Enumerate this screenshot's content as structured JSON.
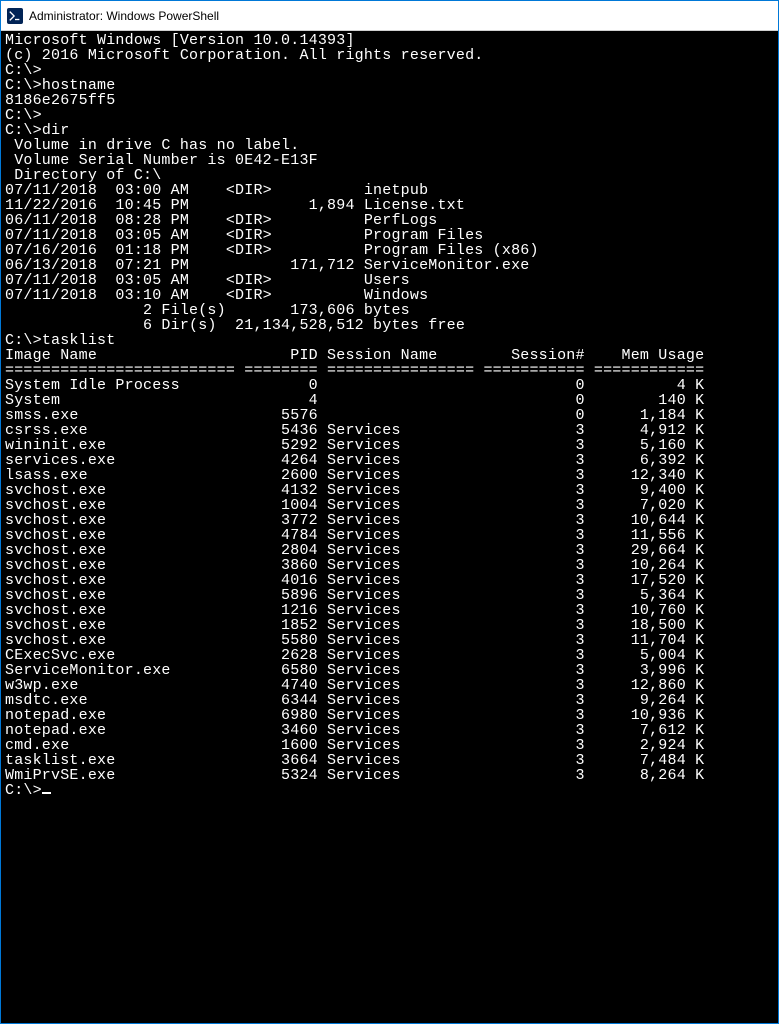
{
  "titlebar": {
    "title": "Administrator: Windows PowerShell"
  },
  "banner": {
    "line1": "Microsoft Windows [Version 10.0.14393]",
    "line2": "(c) 2016 Microsoft Corporation. All rights reserved."
  },
  "prompt": "C:\\>",
  "sessions": {
    "hostname": {
      "cmd": "hostname",
      "output": "8186e2675ff5"
    },
    "dir": {
      "cmd": "dir",
      "vol_line1": " Volume in drive C has no label.",
      "vol_line2": " Volume Serial Number is 0E42-E13F",
      "dir_of": " Directory of C:\\",
      "entries": [
        {
          "date": "07/11/2018",
          "time": "03:00 AM",
          "type": "<DIR>",
          "size": "",
          "name": "inetpub"
        },
        {
          "date": "11/22/2016",
          "time": "10:45 PM",
          "type": "",
          "size": "1,894",
          "name": "License.txt"
        },
        {
          "date": "06/11/2018",
          "time": "08:28 PM",
          "type": "<DIR>",
          "size": "",
          "name": "PerfLogs"
        },
        {
          "date": "07/11/2018",
          "time": "03:05 AM",
          "type": "<DIR>",
          "size": "",
          "name": "Program Files"
        },
        {
          "date": "07/16/2016",
          "time": "01:18 PM",
          "type": "<DIR>",
          "size": "",
          "name": "Program Files (x86)"
        },
        {
          "date": "06/13/2018",
          "time": "07:21 PM",
          "type": "",
          "size": "171,712",
          "name": "ServiceMonitor.exe"
        },
        {
          "date": "07/11/2018",
          "time": "03:05 AM",
          "type": "<DIR>",
          "size": "",
          "name": "Users"
        },
        {
          "date": "07/11/2018",
          "time": "03:10 AM",
          "type": "<DIR>",
          "size": "",
          "name": "Windows"
        }
      ],
      "summary1": {
        "count": "2",
        "label": "File(s)",
        "bytes": "173,606",
        "suffix": "bytes"
      },
      "summary2": {
        "count": "6",
        "label": "Dir(s)",
        "bytes": "21,134,528,512",
        "suffix": "bytes free"
      }
    },
    "tasklist": {
      "cmd": "tasklist",
      "headers": {
        "image": "Image Name",
        "pid": "PID",
        "session": "Session Name",
        "num": "Session#",
        "mem": "Mem Usage"
      },
      "rows": [
        {
          "image": "System Idle Process",
          "pid": "0",
          "session": "",
          "num": "0",
          "mem": "4 K"
        },
        {
          "image": "System",
          "pid": "4",
          "session": "",
          "num": "0",
          "mem": "140 K"
        },
        {
          "image": "smss.exe",
          "pid": "5576",
          "session": "",
          "num": "0",
          "mem": "1,184 K"
        },
        {
          "image": "csrss.exe",
          "pid": "5436",
          "session": "Services",
          "num": "3",
          "mem": "4,912 K"
        },
        {
          "image": "wininit.exe",
          "pid": "5292",
          "session": "Services",
          "num": "3",
          "mem": "5,160 K"
        },
        {
          "image": "services.exe",
          "pid": "4264",
          "session": "Services",
          "num": "3",
          "mem": "6,392 K"
        },
        {
          "image": "lsass.exe",
          "pid": "2600",
          "session": "Services",
          "num": "3",
          "mem": "12,340 K"
        },
        {
          "image": "svchost.exe",
          "pid": "4132",
          "session": "Services",
          "num": "3",
          "mem": "9,400 K"
        },
        {
          "image": "svchost.exe",
          "pid": "1004",
          "session": "Services",
          "num": "3",
          "mem": "7,020 K"
        },
        {
          "image": "svchost.exe",
          "pid": "3772",
          "session": "Services",
          "num": "3",
          "mem": "10,644 K"
        },
        {
          "image": "svchost.exe",
          "pid": "4784",
          "session": "Services",
          "num": "3",
          "mem": "11,556 K"
        },
        {
          "image": "svchost.exe",
          "pid": "2804",
          "session": "Services",
          "num": "3",
          "mem": "29,664 K"
        },
        {
          "image": "svchost.exe",
          "pid": "3860",
          "session": "Services",
          "num": "3",
          "mem": "10,264 K"
        },
        {
          "image": "svchost.exe",
          "pid": "4016",
          "session": "Services",
          "num": "3",
          "mem": "17,520 K"
        },
        {
          "image": "svchost.exe",
          "pid": "5896",
          "session": "Services",
          "num": "3",
          "mem": "5,364 K"
        },
        {
          "image": "svchost.exe",
          "pid": "1216",
          "session": "Services",
          "num": "3",
          "mem": "10,760 K"
        },
        {
          "image": "svchost.exe",
          "pid": "1852",
          "session": "Services",
          "num": "3",
          "mem": "18,500 K"
        },
        {
          "image": "svchost.exe",
          "pid": "5580",
          "session": "Services",
          "num": "3",
          "mem": "11,704 K"
        },
        {
          "image": "CExecSvc.exe",
          "pid": "2628",
          "session": "Services",
          "num": "3",
          "mem": "5,004 K"
        },
        {
          "image": "ServiceMonitor.exe",
          "pid": "6580",
          "session": "Services",
          "num": "3",
          "mem": "3,996 K"
        },
        {
          "image": "w3wp.exe",
          "pid": "4740",
          "session": "Services",
          "num": "3",
          "mem": "12,860 K"
        },
        {
          "image": "msdtc.exe",
          "pid": "6344",
          "session": "Services",
          "num": "3",
          "mem": "9,264 K"
        },
        {
          "image": "notepad.exe",
          "pid": "6980",
          "session": "Services",
          "num": "3",
          "mem": "10,936 K"
        },
        {
          "image": "notepad.exe",
          "pid": "3460",
          "session": "Services",
          "num": "3",
          "mem": "7,612 K"
        },
        {
          "image": "cmd.exe",
          "pid": "1600",
          "session": "Services",
          "num": "3",
          "mem": "2,924 K"
        },
        {
          "image": "tasklist.exe",
          "pid": "3664",
          "session": "Services",
          "num": "3",
          "mem": "7,484 K"
        },
        {
          "image": "WmiPrvSE.exe",
          "pid": "5324",
          "session": "Services",
          "num": "3",
          "mem": "8,264 K"
        }
      ]
    }
  }
}
